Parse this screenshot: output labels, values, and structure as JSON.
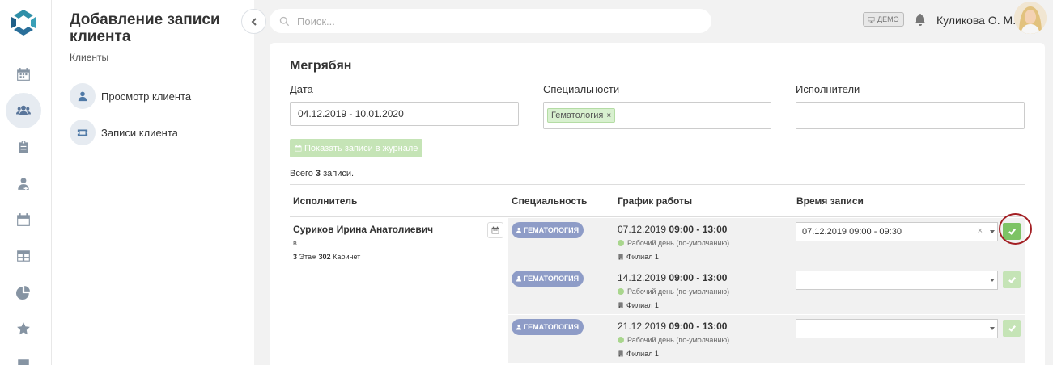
{
  "panel": {
    "title": "Добавление записи клиента",
    "subtitle": "Клиенты",
    "links": [
      {
        "label": "Просмотр клиента",
        "icon": "user-icon"
      },
      {
        "label": "Записи клиента",
        "icon": "ticket-icon"
      }
    ]
  },
  "rail": [
    "calendar-icon",
    "users-icon",
    "clipboard-icon",
    "doctor-icon",
    "calendar-alt-icon",
    "table-icon",
    "pie-chart-icon",
    "star-icon",
    "chat-icon"
  ],
  "topbar": {
    "search_placeholder": "Поиск...",
    "demo_label": "ДЕМО",
    "user_name": "Куликова О. М."
  },
  "form": {
    "title": "Мегрябян",
    "date_label": "Дата",
    "date_value": "04.12.2019 - 10.01.2020",
    "specialties_label": "Специальности",
    "specialty_tag": "Гематология",
    "specialty_tag_remove": "×",
    "executors_label": "Исполнители",
    "show_button": "Показать записи в журнале",
    "total_prefix": "Всего ",
    "total_count": "3",
    "total_suffix": " записи."
  },
  "table": {
    "headers": [
      "Исполнитель",
      "Специальность",
      "График работы",
      "Время записи"
    ],
    "executor": {
      "name": "Суриков Ирина Анатолиевич",
      "sub": "в",
      "floor": "3",
      "floor_label": " Этаж ",
      "room": "302",
      "room_label": " Кабинет"
    },
    "slots": [
      {
        "specialty": "ГЕМАТОЛОГИЯ",
        "date": "07.12.2019 ",
        "hours": "09:00 - 13:00",
        "day": "Рабочий день (по-умолчанию)",
        "branch": "Филиал 1",
        "time_value": "07.12.2019 09:00 - 09:30",
        "clear": "×"
      },
      {
        "specialty": "ГЕМАТОЛОГИЯ",
        "date": "14.12.2019 ",
        "hours": "09:00 - 13:00",
        "day": "Рабочий день (по-умолчанию)",
        "branch": "Филиал 1",
        "time_value": ""
      },
      {
        "specialty": "ГЕМАТОЛОГИЯ",
        "date": "21.12.2019 ",
        "hours": "09:00 - 13:00",
        "day": "Рабочий день (по-умолчанию)",
        "branch": "Филиал 1",
        "time_value": ""
      }
    ]
  },
  "colors": {
    "accent_green": "#7dc365",
    "light_green": "#c5e4b6",
    "badge_purple": "#8e9cc7",
    "highlight_ring": "#a31f24"
  }
}
